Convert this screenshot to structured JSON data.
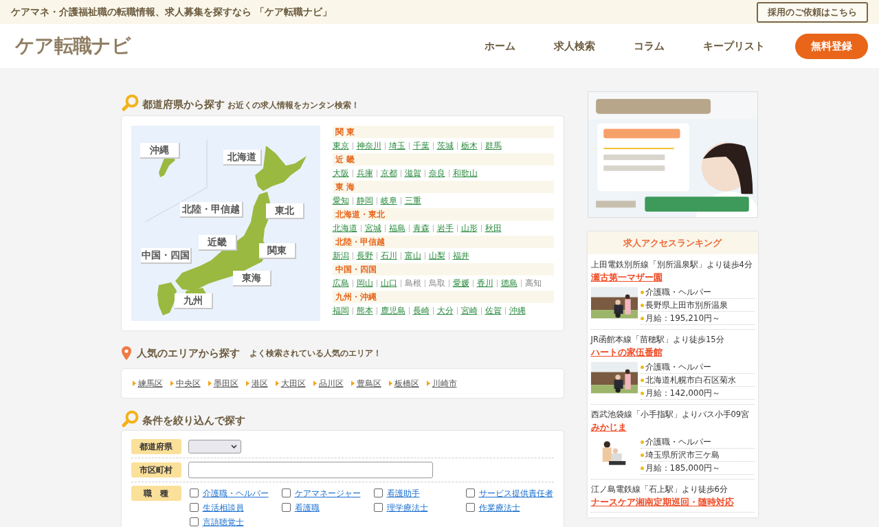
{
  "topbar": {
    "tagline": "ケアマネ・介護福祉職の転職情報、求人募集を探すなら 「ケア転職ナビ」",
    "employer_button": "採用のご依頼はこちら"
  },
  "header": {
    "logo": "ケア転職ナビ",
    "nav": [
      "ホーム",
      "求人検索",
      "コラム",
      "キープリスト"
    ],
    "register_button": "無料登録"
  },
  "prefecture_search": {
    "title": "都道府県から探す",
    "subtitle": "お近くの求人情報をカンタン検索！",
    "map_labels": [
      "沖縄",
      "北海道",
      "北陸・甲信越",
      "東北",
      "近畿",
      "中国・四国",
      "関東",
      "東海",
      "九州"
    ],
    "regions": [
      {
        "name": "関 東",
        "prefectures": [
          {
            "name": "東京",
            "link": true
          },
          {
            "name": "神奈川",
            "link": true
          },
          {
            "name": "埼玉",
            "link": true
          },
          {
            "name": "千葉",
            "link": true
          },
          {
            "name": "茨城",
            "link": true
          },
          {
            "name": "栃木",
            "link": true
          },
          {
            "name": "群馬",
            "link": true
          }
        ]
      },
      {
        "name": "近 畿",
        "prefectures": [
          {
            "name": "大阪",
            "link": true
          },
          {
            "name": "兵庫",
            "link": true
          },
          {
            "name": "京都",
            "link": true
          },
          {
            "name": "滋賀",
            "link": true
          },
          {
            "name": "奈良",
            "link": true
          },
          {
            "name": "和歌山",
            "link": true
          }
        ]
      },
      {
        "name": "東 海",
        "prefectures": [
          {
            "name": "愛知",
            "link": true
          },
          {
            "name": "静岡",
            "link": true
          },
          {
            "name": "岐阜",
            "link": true
          },
          {
            "name": "三重",
            "link": true
          }
        ]
      },
      {
        "name": "北海道・東北",
        "prefectures": [
          {
            "name": "北海道",
            "link": true
          },
          {
            "name": "宮城",
            "link": true
          },
          {
            "name": "福島",
            "link": true
          },
          {
            "name": "青森",
            "link": true
          },
          {
            "name": "岩手",
            "link": true
          },
          {
            "name": "山形",
            "link": true
          },
          {
            "name": "秋田",
            "link": true
          }
        ]
      },
      {
        "name": "北陸・甲信越",
        "prefectures": [
          {
            "name": "新潟",
            "link": true
          },
          {
            "name": "長野",
            "link": true
          },
          {
            "name": "石川",
            "link": true
          },
          {
            "name": "富山",
            "link": true
          },
          {
            "name": "山梨",
            "link": true
          },
          {
            "name": "福井",
            "link": true
          }
        ]
      },
      {
        "name": "中国・四国",
        "prefectures": [
          {
            "name": "広島",
            "link": true
          },
          {
            "name": "岡山",
            "link": true
          },
          {
            "name": "山口",
            "link": true
          },
          {
            "name": "島根",
            "link": false
          },
          {
            "name": "鳥取",
            "link": false
          },
          {
            "name": "愛媛",
            "link": true
          },
          {
            "name": "香川",
            "link": true
          },
          {
            "name": "徳島",
            "link": true
          },
          {
            "name": "高知",
            "link": false
          }
        ]
      },
      {
        "name": "九州・沖縄",
        "prefectures": [
          {
            "name": "福岡",
            "link": true
          },
          {
            "name": "熊本",
            "link": true
          },
          {
            "name": "鹿児島",
            "link": true
          },
          {
            "name": "長崎",
            "link": true
          },
          {
            "name": "大分",
            "link": true
          },
          {
            "name": "宮崎",
            "link": true
          },
          {
            "name": "佐賀",
            "link": true
          },
          {
            "name": "沖縄",
            "link": true
          }
        ]
      }
    ]
  },
  "popular_areas": {
    "title": "人気のエリアから探す",
    "subtitle": "よく検索されている人気のエリア！",
    "areas": [
      "練馬区",
      "中央区",
      "墨田区",
      "港区",
      "大田区",
      "品川区",
      "豊島区",
      "板橋区",
      "川崎市"
    ]
  },
  "conditions": {
    "title": "条件を絞り込んで探す",
    "prefecture_label": "都道府県",
    "city_label": "市区町村",
    "job_label": "職　種",
    "jobs": [
      {
        "label": "介護職・ヘルパー",
        "checked": false
      },
      {
        "label": "ケアマネージャー",
        "checked": false
      },
      {
        "label": "看護助手",
        "checked": false
      },
      {
        "label": "サービス提供責任者",
        "checked": false
      },
      {
        "label": "生活相談員",
        "checked": false
      },
      {
        "label": "看護職",
        "checked": false
      },
      {
        "label": "理学療法士",
        "checked": false
      },
      {
        "label": "作業療法士",
        "checked": false
      },
      {
        "label": "言語聴覚士",
        "checked": false
      }
    ]
  },
  "ranking": {
    "title": "求人アクセスランキング",
    "items": [
      {
        "access": "上田電鉄別所線「別所温泉駅」より徒歩4分",
        "name": "瀬古第一マザー園",
        "details": [
          "介護職・ヘルパー",
          "長野県上田市別所温泉",
          "月給：195,210円～"
        ]
      },
      {
        "access": "JR函館本線「苗穂駅」より徒歩15分",
        "name": "ハートの家伍番館",
        "details": [
          "介護職・ヘルパー",
          "北海道札幌市白石区菊水",
          "月給：142,000円～"
        ]
      },
      {
        "access": "西武池袋線「小手指駅」よりバス小手09宮",
        "name": "みかじま",
        "details": [
          "介護職・ヘルパー",
          "埼玉県所沢市三ケ島",
          "月給：185,000円～"
        ]
      },
      {
        "access": "江ノ島電鉄線「石上駅」より徒歩6分",
        "name": "ナースケア湘南定期巡回・随時対応"
      }
    ]
  }
}
